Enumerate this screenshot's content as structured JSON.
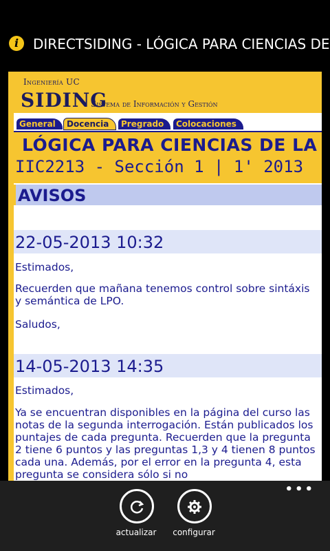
{
  "app": {
    "title": "DIRECTSIDING - LÓGICA PARA CIENCIAS DE LA COMPUTACIÓN",
    "info_icon": "info-icon"
  },
  "site": {
    "brand_top": "Ingeniería UC",
    "brand_logo": "SIDING",
    "brand_sub": "Sistema de Información y Gestión",
    "tabs": [
      {
        "label": "General"
      },
      {
        "label": "Docencia"
      },
      {
        "label": "Pregrado"
      },
      {
        "label": "Colocaciones"
      }
    ],
    "course_title": "LÓGICA PARA CIENCIAS DE LA",
    "course_sub": "IIC2213 - Sección 1 | 1' 2013",
    "section_title": "AVISOS"
  },
  "notices": [
    {
      "date": "22-05-2013 10:32",
      "paragraphs": [
        "Estimados,",
        "Recuerden que mañana tenemos control sobre sintáxis y semántica de LPO.",
        "Saludos,"
      ]
    },
    {
      "date": "14-05-2013 14:35",
      "paragraphs": [
        "Estimados,",
        "Ya se encuentran disponibles en la página del curso las notas de la segunda interrogación. Están publicados los puntajes de cada pregunta. Recuerden que la pregunta 2 tiene 6 puntos y las preguntas 1,3 y 4 tienen 8 puntos cada una. Además, por el error en la pregunta 4, esta pregunta se considera sólo si no"
      ]
    }
  ],
  "appbar": {
    "more": "•••",
    "buttons": [
      {
        "label": "actualizar",
        "icon": "refresh-icon"
      },
      {
        "label": "configurar",
        "icon": "gear-icon"
      }
    ]
  }
}
